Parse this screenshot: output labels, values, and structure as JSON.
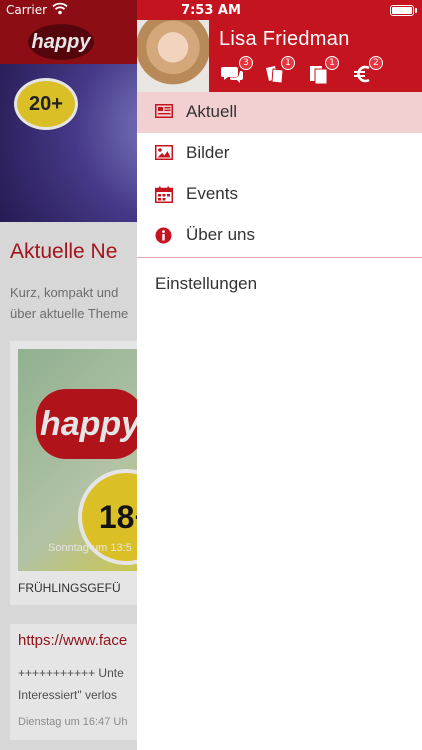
{
  "status_bar": {
    "carrier": "Carrier",
    "time": "7:53 AM"
  },
  "background": {
    "logo": "happy",
    "badge": "20+",
    "news_title": "Aktuelle Ne",
    "news_text_1": "Kurz, kompakt und",
    "news_text_2": "über aktuelle Theme",
    "card_badge": "18+",
    "card_date": "Sonntag um 13:5",
    "card_caption": "FRÜHLINGSGEFÜ",
    "card2_link": "https://www.face",
    "card2_text_1": "+++++++++++ Unte",
    "card2_text_2": "Interessiert\" verlos",
    "card2_date": "Dienstag um 16:47 Uh"
  },
  "drawer": {
    "user_name": "Lisa Friedman",
    "icons": [
      {
        "name": "chat-icon",
        "badge": "3"
      },
      {
        "name": "tickets-icon",
        "badge": "1"
      },
      {
        "name": "documents-icon",
        "badge": "1"
      },
      {
        "name": "euro-icon",
        "badge": "2"
      }
    ],
    "menu": [
      {
        "name": "menu-item-aktuell",
        "icon": "newspaper-icon",
        "label": "Aktuell",
        "active": true
      },
      {
        "name": "menu-item-bilder",
        "icon": "image-icon",
        "label": "Bilder",
        "active": false
      },
      {
        "name": "menu-item-events",
        "icon": "calendar-icon",
        "label": "Events",
        "active": false
      },
      {
        "name": "menu-item-ueber-uns",
        "icon": "info-icon",
        "label": "Über uns",
        "active": false
      }
    ],
    "settings_label": "Einstellungen"
  },
  "colors": {
    "brand_red": "#c31420",
    "active_bg": "#f2cfd1",
    "icon_red": "#c31420"
  }
}
